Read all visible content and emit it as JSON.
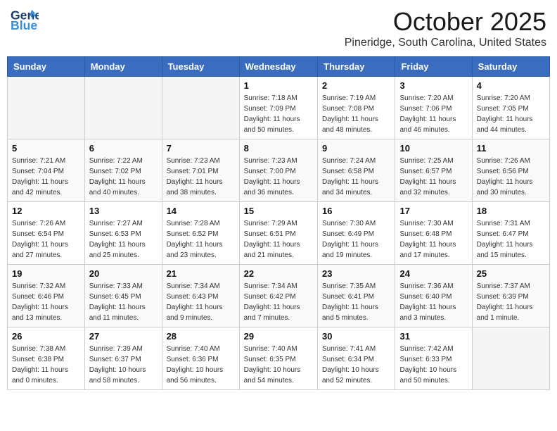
{
  "header": {
    "logo_line1": "General",
    "logo_line2": "Blue",
    "month": "October 2025",
    "location": "Pineridge, South Carolina, United States"
  },
  "days_of_week": [
    "Sunday",
    "Monday",
    "Tuesday",
    "Wednesday",
    "Thursday",
    "Friday",
    "Saturday"
  ],
  "weeks": [
    [
      {
        "day": "",
        "empty": true
      },
      {
        "day": "",
        "empty": true
      },
      {
        "day": "",
        "empty": true
      },
      {
        "day": "1",
        "sunrise": "7:18 AM",
        "sunset": "7:09 PM",
        "daylight": "11 hours and 50 minutes."
      },
      {
        "day": "2",
        "sunrise": "7:19 AM",
        "sunset": "7:08 PM",
        "daylight": "11 hours and 48 minutes."
      },
      {
        "day": "3",
        "sunrise": "7:20 AM",
        "sunset": "7:06 PM",
        "daylight": "11 hours and 46 minutes."
      },
      {
        "day": "4",
        "sunrise": "7:20 AM",
        "sunset": "7:05 PM",
        "daylight": "11 hours and 44 minutes."
      }
    ],
    [
      {
        "day": "5",
        "sunrise": "7:21 AM",
        "sunset": "7:04 PM",
        "daylight": "11 hours and 42 minutes."
      },
      {
        "day": "6",
        "sunrise": "7:22 AM",
        "sunset": "7:02 PM",
        "daylight": "11 hours and 40 minutes."
      },
      {
        "day": "7",
        "sunrise": "7:23 AM",
        "sunset": "7:01 PM",
        "daylight": "11 hours and 38 minutes."
      },
      {
        "day": "8",
        "sunrise": "7:23 AM",
        "sunset": "7:00 PM",
        "daylight": "11 hours and 36 minutes."
      },
      {
        "day": "9",
        "sunrise": "7:24 AM",
        "sunset": "6:58 PM",
        "daylight": "11 hours and 34 minutes."
      },
      {
        "day": "10",
        "sunrise": "7:25 AM",
        "sunset": "6:57 PM",
        "daylight": "11 hours and 32 minutes."
      },
      {
        "day": "11",
        "sunrise": "7:26 AM",
        "sunset": "6:56 PM",
        "daylight": "11 hours and 30 minutes."
      }
    ],
    [
      {
        "day": "12",
        "sunrise": "7:26 AM",
        "sunset": "6:54 PM",
        "daylight": "11 hours and 27 minutes."
      },
      {
        "day": "13",
        "sunrise": "7:27 AM",
        "sunset": "6:53 PM",
        "daylight": "11 hours and 25 minutes."
      },
      {
        "day": "14",
        "sunrise": "7:28 AM",
        "sunset": "6:52 PM",
        "daylight": "11 hours and 23 minutes."
      },
      {
        "day": "15",
        "sunrise": "7:29 AM",
        "sunset": "6:51 PM",
        "daylight": "11 hours and 21 minutes."
      },
      {
        "day": "16",
        "sunrise": "7:30 AM",
        "sunset": "6:49 PM",
        "daylight": "11 hours and 19 minutes."
      },
      {
        "day": "17",
        "sunrise": "7:30 AM",
        "sunset": "6:48 PM",
        "daylight": "11 hours and 17 minutes."
      },
      {
        "day": "18",
        "sunrise": "7:31 AM",
        "sunset": "6:47 PM",
        "daylight": "11 hours and 15 minutes."
      }
    ],
    [
      {
        "day": "19",
        "sunrise": "7:32 AM",
        "sunset": "6:46 PM",
        "daylight": "11 hours and 13 minutes."
      },
      {
        "day": "20",
        "sunrise": "7:33 AM",
        "sunset": "6:45 PM",
        "daylight": "11 hours and 11 minutes."
      },
      {
        "day": "21",
        "sunrise": "7:34 AM",
        "sunset": "6:43 PM",
        "daylight": "11 hours and 9 minutes."
      },
      {
        "day": "22",
        "sunrise": "7:34 AM",
        "sunset": "6:42 PM",
        "daylight": "11 hours and 7 minutes."
      },
      {
        "day": "23",
        "sunrise": "7:35 AM",
        "sunset": "6:41 PM",
        "daylight": "11 hours and 5 minutes."
      },
      {
        "day": "24",
        "sunrise": "7:36 AM",
        "sunset": "6:40 PM",
        "daylight": "11 hours and 3 minutes."
      },
      {
        "day": "25",
        "sunrise": "7:37 AM",
        "sunset": "6:39 PM",
        "daylight": "11 hours and 1 minute."
      }
    ],
    [
      {
        "day": "26",
        "sunrise": "7:38 AM",
        "sunset": "6:38 PM",
        "daylight": "11 hours and 0 minutes."
      },
      {
        "day": "27",
        "sunrise": "7:39 AM",
        "sunset": "6:37 PM",
        "daylight": "10 hours and 58 minutes."
      },
      {
        "day": "28",
        "sunrise": "7:40 AM",
        "sunset": "6:36 PM",
        "daylight": "10 hours and 56 minutes."
      },
      {
        "day": "29",
        "sunrise": "7:40 AM",
        "sunset": "6:35 PM",
        "daylight": "10 hours and 54 minutes."
      },
      {
        "day": "30",
        "sunrise": "7:41 AM",
        "sunset": "6:34 PM",
        "daylight": "10 hours and 52 minutes."
      },
      {
        "day": "31",
        "sunrise": "7:42 AM",
        "sunset": "6:33 PM",
        "daylight": "10 hours and 50 minutes."
      },
      {
        "day": "",
        "empty": true
      }
    ]
  ],
  "labels": {
    "sunrise_prefix": "Sunrise: ",
    "sunset_prefix": "Sunset: ",
    "daylight_prefix": "Daylight: "
  }
}
